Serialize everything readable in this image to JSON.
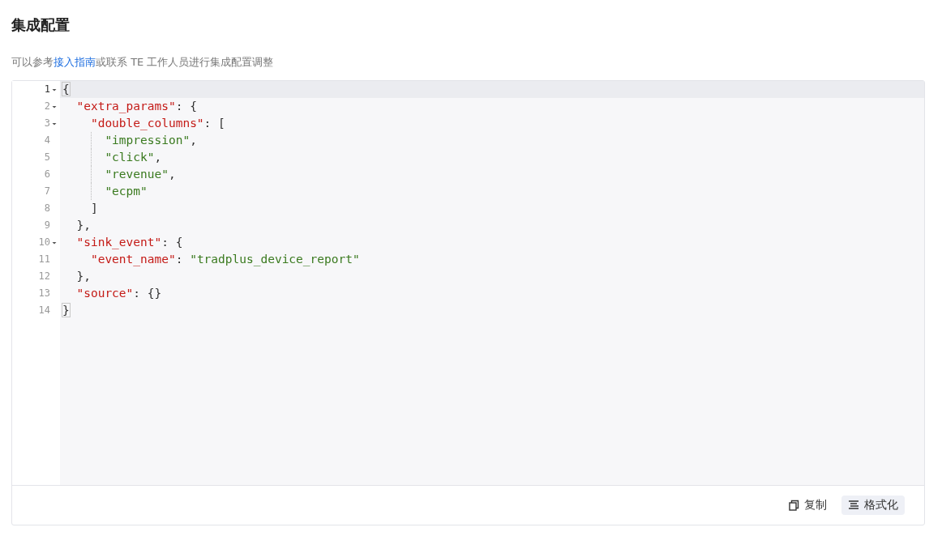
{
  "page_title": "集成配置",
  "description": {
    "before": "可以参考",
    "link": "接入指南",
    "after": "或联系 TE 工作人员进行集成配置调整"
  },
  "editor": {
    "lines": [
      {
        "number": "1",
        "foldable": true,
        "selected": true,
        "indent_guide": false,
        "tokens": [
          {
            "kind": "bracket-match",
            "text": "{"
          }
        ]
      },
      {
        "number": "2",
        "foldable": true,
        "selected": false,
        "indent_guide": false,
        "tokens": [
          {
            "kind": "key",
            "text": "  \"extra_params\""
          },
          {
            "kind": "punct",
            "text": ": {"
          }
        ]
      },
      {
        "number": "3",
        "foldable": true,
        "selected": false,
        "indent_guide": false,
        "tokens": [
          {
            "kind": "key",
            "text": "    \"double_columns\""
          },
          {
            "kind": "punct",
            "text": ": ["
          }
        ]
      },
      {
        "number": "4",
        "foldable": false,
        "selected": false,
        "indent_guide": true,
        "tokens": [
          {
            "kind": "string",
            "text": "      \"impression\""
          },
          {
            "kind": "punct",
            "text": ","
          }
        ]
      },
      {
        "number": "5",
        "foldable": false,
        "selected": false,
        "indent_guide": true,
        "tokens": [
          {
            "kind": "string",
            "text": "      \"click\""
          },
          {
            "kind": "punct",
            "text": ","
          }
        ]
      },
      {
        "number": "6",
        "foldable": false,
        "selected": false,
        "indent_guide": true,
        "tokens": [
          {
            "kind": "string",
            "text": "      \"revenue\""
          },
          {
            "kind": "punct",
            "text": ","
          }
        ]
      },
      {
        "number": "7",
        "foldable": false,
        "selected": false,
        "indent_guide": true,
        "tokens": [
          {
            "kind": "string",
            "text": "      \"ecpm\""
          }
        ]
      },
      {
        "number": "8",
        "foldable": false,
        "selected": false,
        "indent_guide": false,
        "tokens": [
          {
            "kind": "punct",
            "text": "    ]"
          }
        ]
      },
      {
        "number": "9",
        "foldable": false,
        "selected": false,
        "indent_guide": false,
        "tokens": [
          {
            "kind": "punct",
            "text": "  },"
          }
        ]
      },
      {
        "number": "10",
        "foldable": true,
        "selected": false,
        "indent_guide": false,
        "tokens": [
          {
            "kind": "key",
            "text": "  \"sink_event\""
          },
          {
            "kind": "punct",
            "text": ": {"
          }
        ]
      },
      {
        "number": "11",
        "foldable": false,
        "selected": false,
        "indent_guide": false,
        "tokens": [
          {
            "kind": "key",
            "text": "    \"event_name\""
          },
          {
            "kind": "punct",
            "text": ": "
          },
          {
            "kind": "string",
            "text": "\"tradplus_device_report\""
          }
        ]
      },
      {
        "number": "12",
        "foldable": false,
        "selected": false,
        "indent_guide": false,
        "tokens": [
          {
            "kind": "punct",
            "text": "  },"
          }
        ]
      },
      {
        "number": "13",
        "foldable": false,
        "selected": false,
        "indent_guide": false,
        "tokens": [
          {
            "kind": "key",
            "text": "  \"source\""
          },
          {
            "kind": "punct",
            "text": ": {}"
          }
        ]
      },
      {
        "number": "14",
        "foldable": false,
        "selected": false,
        "indent_guide": false,
        "tokens": [
          {
            "kind": "bracket-match",
            "text": "}"
          }
        ]
      }
    ]
  },
  "actions": [
    {
      "kind": "copy",
      "label": "复制",
      "selected": false
    },
    {
      "kind": "format",
      "label": "格式化",
      "selected": true
    }
  ]
}
